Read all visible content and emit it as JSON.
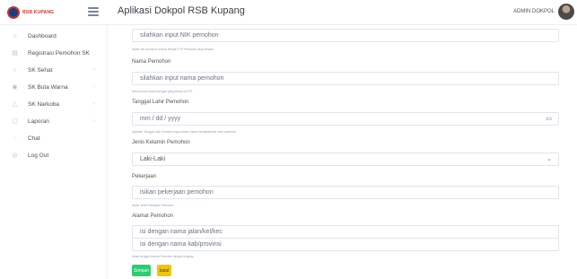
{
  "brand": {
    "text": "RSB KUPANG"
  },
  "header": {
    "title": "Aplikasi Dokpol RSB Kupang",
    "user": "ADMIN DOKPOL"
  },
  "sidebar": {
    "items": [
      {
        "label": "Dashboard",
        "icon": "home-icon",
        "has_submenu": false
      },
      {
        "label": "Registrasi Pemohon SK",
        "icon": "clipboard-icon",
        "has_submenu": false
      },
      {
        "label": "SK Sehat",
        "icon": "circle-icon",
        "has_submenu": true
      },
      {
        "label": "SK Buta Warna",
        "icon": "eye-icon",
        "has_submenu": true
      },
      {
        "label": "SK Narkoba",
        "icon": "warning-icon",
        "has_submenu": true
      },
      {
        "label": "Laporan",
        "icon": "document-icon",
        "has_submenu": true
      },
      {
        "label": "Chat",
        "icon": "chat-icon",
        "has_submenu": false
      },
      {
        "label": "Log Out",
        "icon": "logout-icon",
        "has_submenu": false
      }
    ]
  },
  "form": {
    "nik": {
      "placeholder": "silahkan input NIK pemohon",
      "help": "Isikan NIK pemohon sesuai dengan KTP Pemohon yang berlaku"
    },
    "nama": {
      "label": "Nama Pemohon",
      "placeholder": "silahkan input nama pemohon",
      "help": "Nama harus sesuai dengan yang tertera di KTP"
    },
    "tanggal": {
      "label": "Tanggal Lahir Pemohon",
      "placeholder": "mm / dd / yyyy",
      "help": "Inputkan Tanggal Lahir Pemohon agar sistem dapat mengkalkulasi umur pemohon"
    },
    "jenis_kelamin": {
      "label": "Jenis Kelamin Pemohon",
      "value": "Laki-Laki"
    },
    "pekerjaan": {
      "label": "Pekerjaan",
      "placeholder": "isikan pekerjaan pemohon",
      "help": "Isikan Jenis Pekerjaan Pemohon"
    },
    "alamat": {
      "label": "Alamat Pemohon",
      "placeholder1": "isi dengan nama jalan/kel/kec",
      "placeholder2": "isi dengan nama kab/provinsi",
      "help": "Isikan dengan Alamat Pemohon dengan lengkap"
    },
    "buttons": {
      "save": "Simpan",
      "cancel": "batal"
    }
  }
}
